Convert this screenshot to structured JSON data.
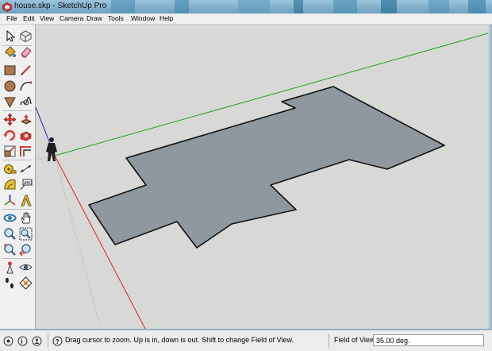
{
  "window": {
    "title": "house.skp - SketchUp Pro",
    "app_icon": "sketchup-icon"
  },
  "menu": {
    "items": [
      "File",
      "Edit",
      "View",
      "Camera",
      "Draw",
      "Tools",
      "Window",
      "Help"
    ]
  },
  "toolbar": {
    "tools": [
      "select-icon",
      "make-component-icon",
      "paint-bucket-icon",
      "eraser-icon",
      "rectangle-icon",
      "line-icon",
      "circle-icon",
      "arc-icon",
      "polygon-icon",
      "freehand-icon",
      "move-icon",
      "push-pull-icon",
      "rotate-icon",
      "follow-me-icon",
      "scale-icon",
      "offset-icon",
      "tape-measure-icon",
      "dimension-icon",
      "protractor-icon",
      "text-icon",
      "axes-icon",
      "3d-text-icon",
      "orbit-icon",
      "pan-icon",
      "zoom-icon",
      "zoom-window-icon",
      "zoom-extents-icon",
      "previous-view-icon",
      "position-camera-icon",
      "look-around-icon",
      "walk-icon",
      "section-plane-icon"
    ]
  },
  "scene": {
    "axis_colors": {
      "red": "#e02020",
      "green": "#20a020",
      "blue": "#2020c0"
    },
    "face_color": "#8f989e",
    "background_color": "#d8d8d6",
    "figure": "person-figure"
  },
  "statusbar": {
    "icons": [
      "geo-location-icon",
      "credits-icon",
      "user-icon",
      "help-icon"
    ],
    "message": "Drag cursor to zoom.  Up is in, down is out. Shift to change Field of View.",
    "measurement_label": "Field of View",
    "measurement_value": "35.00 deg."
  }
}
